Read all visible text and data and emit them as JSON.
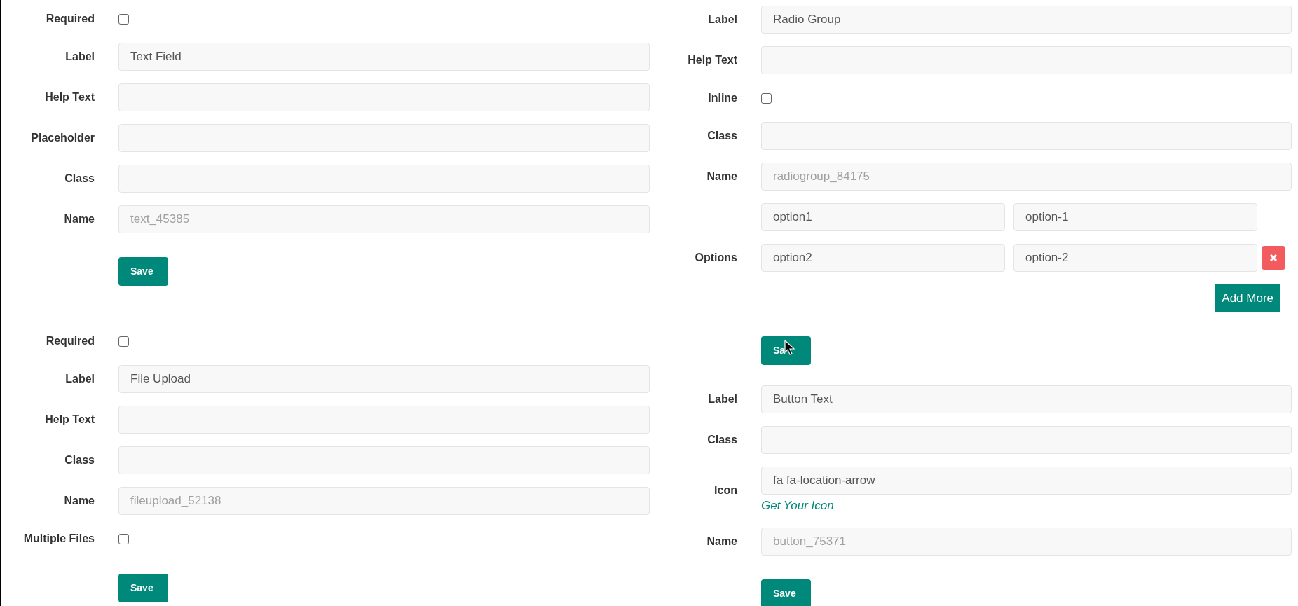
{
  "left_column": [
    {
      "fields": [
        {
          "kind": "checkbox",
          "label": "Required",
          "checked": false
        },
        {
          "kind": "text",
          "label": "Label",
          "value": "Text Field"
        },
        {
          "kind": "text",
          "label": "Help Text"
        },
        {
          "kind": "text",
          "label": "Placeholder"
        },
        {
          "kind": "text",
          "label": "Class"
        },
        {
          "kind": "text",
          "label": "Name",
          "placeholder": "text_45385"
        }
      ],
      "save_button": "Save"
    },
    {
      "fields": [
        {
          "kind": "checkbox",
          "label": "Required",
          "checked": false
        },
        {
          "kind": "text",
          "label": "Label",
          "value": "File Upload"
        },
        {
          "kind": "text",
          "label": "Help Text"
        },
        {
          "kind": "text",
          "label": "Class"
        },
        {
          "kind": "text",
          "label": "Name",
          "placeholder": "fileupload_52138"
        },
        {
          "kind": "checkbox",
          "label": "Multiple Files",
          "checked": false
        }
      ],
      "save_button": "Save"
    }
  ],
  "right_column": [
    {
      "fields": [
        {
          "kind": "text",
          "label": "Label",
          "value": "Radio Group"
        },
        {
          "kind": "text",
          "label": "Help Text"
        },
        {
          "kind": "checkbox",
          "label": "Inline",
          "checked": false
        },
        {
          "kind": "text",
          "label": "Class"
        },
        {
          "kind": "text",
          "label": "Name",
          "placeholder": "radiogroup_84175"
        },
        {
          "kind": "options",
          "label": "Options",
          "rows": [
            {
              "label": "option1",
              "value": "option-1",
              "removable": false
            },
            {
              "label": "option2",
              "value": "option-2",
              "removable": true
            }
          ],
          "add_button": "Add More"
        }
      ],
      "save_button": "Sa",
      "cursor": true
    },
    {
      "fields": [
        {
          "kind": "text",
          "label": "Label",
          "value": "Button Text"
        },
        {
          "kind": "text",
          "label": "Class"
        },
        {
          "kind": "text",
          "label": "Icon",
          "value": "fa fa-location-arrow",
          "link": "Get Your Icon"
        },
        {
          "kind": "text",
          "label": "Name",
          "placeholder": "button_75371"
        }
      ],
      "save_button": "Save"
    }
  ]
}
